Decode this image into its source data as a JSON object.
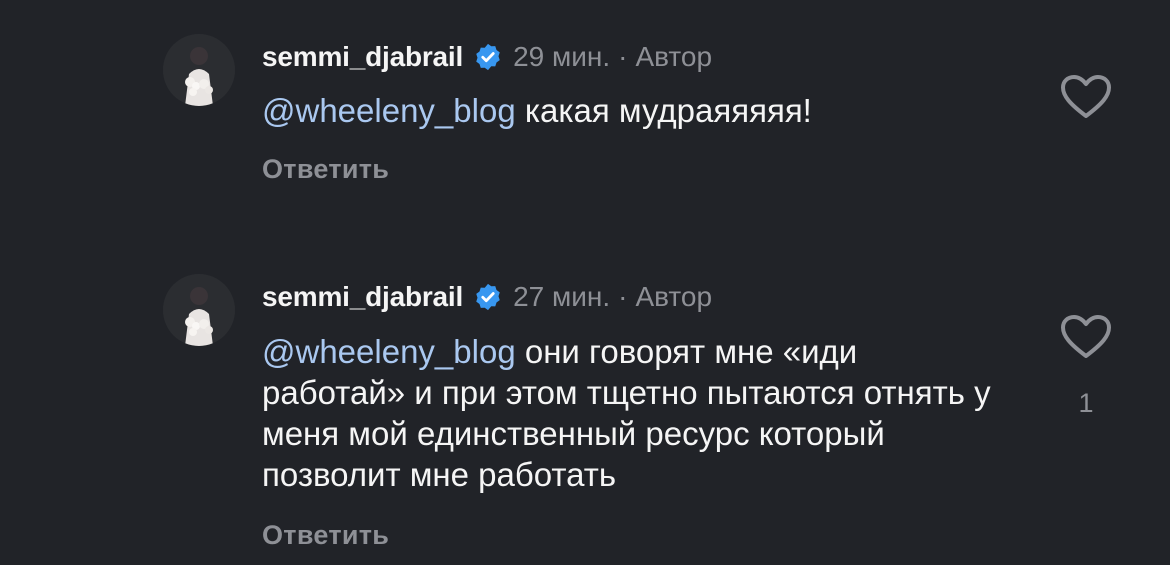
{
  "comments": [
    {
      "username": "semmi_djabrail",
      "verified_icon": "verified-badge-icon",
      "time": "29 мин.",
      "separator": "·",
      "author_label": "Автор",
      "mention": "@wheeleny_blog",
      "text": "какая мудраяяяяя!",
      "reply_label": "Ответить",
      "like_icon": "heart-outline-icon",
      "like_count": ""
    },
    {
      "username": "semmi_djabrail",
      "verified_icon": "verified-badge-icon",
      "time": "27 мин.",
      "separator": "·",
      "author_label": "Автор",
      "mention": "@wheeleny_blog",
      "text": "они говорят мне «иди работай» и при этом тщетно пытаются отнять у меня мой единственный ресурс который позволит мне работать",
      "reply_label": "Ответить",
      "like_icon": "heart-outline-icon",
      "like_count": "1"
    }
  ],
  "colors": {
    "background": "#212328",
    "text": "#f5f5f5",
    "muted": "#8e9096",
    "mention": "#aac8f0",
    "verified": "#3897f0"
  }
}
